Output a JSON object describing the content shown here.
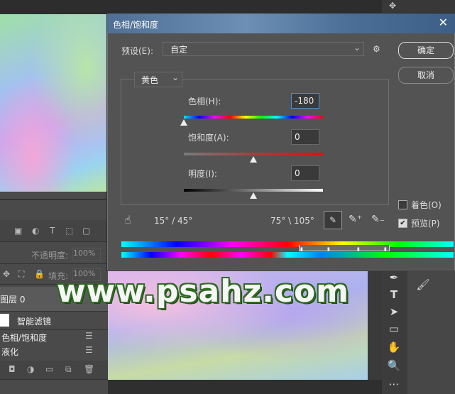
{
  "dialog": {
    "title": "色相/饱和度",
    "close": "✕",
    "preset_label": "预设(E):",
    "preset_value": "自定",
    "ok_label": "确定",
    "cancel_label": "取消",
    "channel_value": "黄色",
    "hue_label": "色相(H):",
    "hue_value": "-180",
    "saturation_label": "饱和度(A):",
    "saturation_value": "0",
    "lightness_label": "明度(I):",
    "lightness_value": "0",
    "range_left": "15° / 45°",
    "range_right": "75° \\ 105°",
    "colorize_label": "着色(O)",
    "colorize_checked": false,
    "preview_label": "预览(P)",
    "preview_checked": true,
    "hue_slider_fraction": 0.0,
    "saturation_slider_fraction": 0.5,
    "lightness_slider_fraction": 0.5
  },
  "layers_panel": {
    "opacity_label": "不透明度:",
    "opacity_value": "100%",
    "fill_label": "填充:",
    "fill_value": "100%",
    "layer_name": "图层 0",
    "smart_filters_label": "智能滤镜",
    "filter1": "色相/饱和度",
    "filter2": "液化",
    "panel_arrows": "◂◂"
  },
  "watermark": "www.psahz.com",
  "colors": {
    "dialog_bg": "#535353",
    "title_gradient_start": "#4f6f95",
    "accent_field_border": "#4a90d9",
    "watermark_outline": "#2e6b22"
  }
}
